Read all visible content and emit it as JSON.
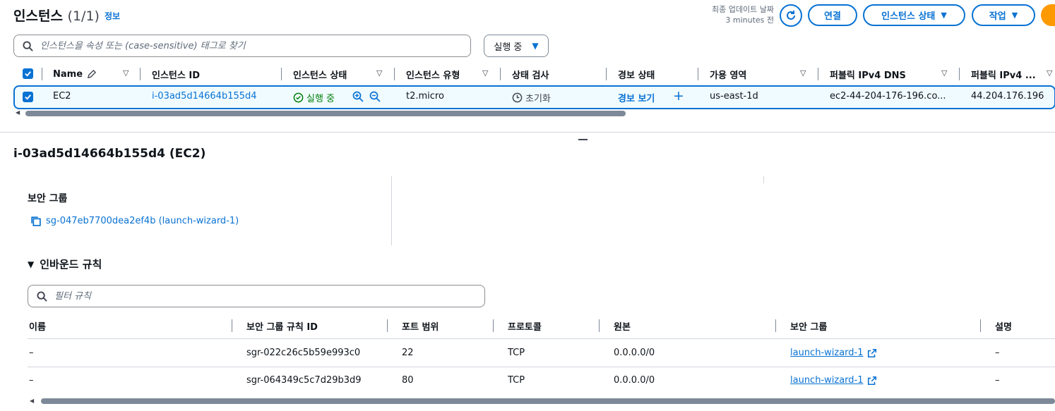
{
  "header": {
    "title": "인스턴스",
    "count": "(1/1)",
    "info_link": "정보",
    "updated_line1": "최종 업데이트 날짜",
    "updated_line2": "3 minutes 전",
    "connect_label": "연결",
    "instance_state_label": "인스턴스 상태",
    "actions_label": "작업"
  },
  "search": {
    "placeholder": "인스턴스을 속성 또는 (case-sensitive) 태그로 찾기",
    "state_filter": "실행 중"
  },
  "table": {
    "columns": [
      "Name",
      "인스턴스 ID",
      "인스턴스 상태",
      "인스턴스 유형",
      "상태 검사",
      "경보 상태",
      "가용 영역",
      "퍼블릭 IPv4 DNS",
      "퍼블릭 IPv4 ..."
    ],
    "rows": [
      {
        "name": "EC2",
        "instance_id": "i-03ad5d14664b155d4",
        "state": "실행 중",
        "type": "t2.micro",
        "status_check": "초기화",
        "alarm": "경보 보기",
        "az": "us-east-1d",
        "public_dns": "ec2-44-204-176-196.co...",
        "public_ip": "44.204.176.196"
      }
    ]
  },
  "details": {
    "title": "i-03ad5d14664b155d4 (EC2)",
    "security_group_label": "보안 그룹",
    "security_group_link": "sg-047eb7700dea2ef4b (launch-wizard-1)",
    "inbound_title": "인바운드 규칙",
    "filter_placeholder": "필터 규칙",
    "rule_columns": [
      "이름",
      "보안 그룹 규칙 ID",
      "포트 범위",
      "프로토콜",
      "원본",
      "보안 그룹",
      "설명"
    ],
    "rules": [
      {
        "name": "–",
        "rule_id": "sgr-022c26c5b59e993c0",
        "port": "22",
        "protocol": "TCP",
        "source": "0.0.0.0/0",
        "group": "launch-wizard-1",
        "desc": "–"
      },
      {
        "name": "–",
        "rule_id": "sgr-064349c5c7d29b3d9",
        "port": "80",
        "protocol": "TCP",
        "source": "0.0.0.0/0",
        "group": "launch-wizard-1",
        "desc": "–"
      }
    ]
  },
  "colors": {
    "accent": "#0972d3",
    "success": "#037f0c",
    "orange": "#ff9900"
  },
  "icons": [
    "refresh-icon",
    "search-icon",
    "caret-down-icon",
    "check-icon",
    "pencil-icon",
    "check-circle-icon",
    "zoom-in-icon",
    "zoom-out-icon",
    "clock-icon",
    "plus-icon",
    "copy-icon",
    "external-link-icon"
  ]
}
